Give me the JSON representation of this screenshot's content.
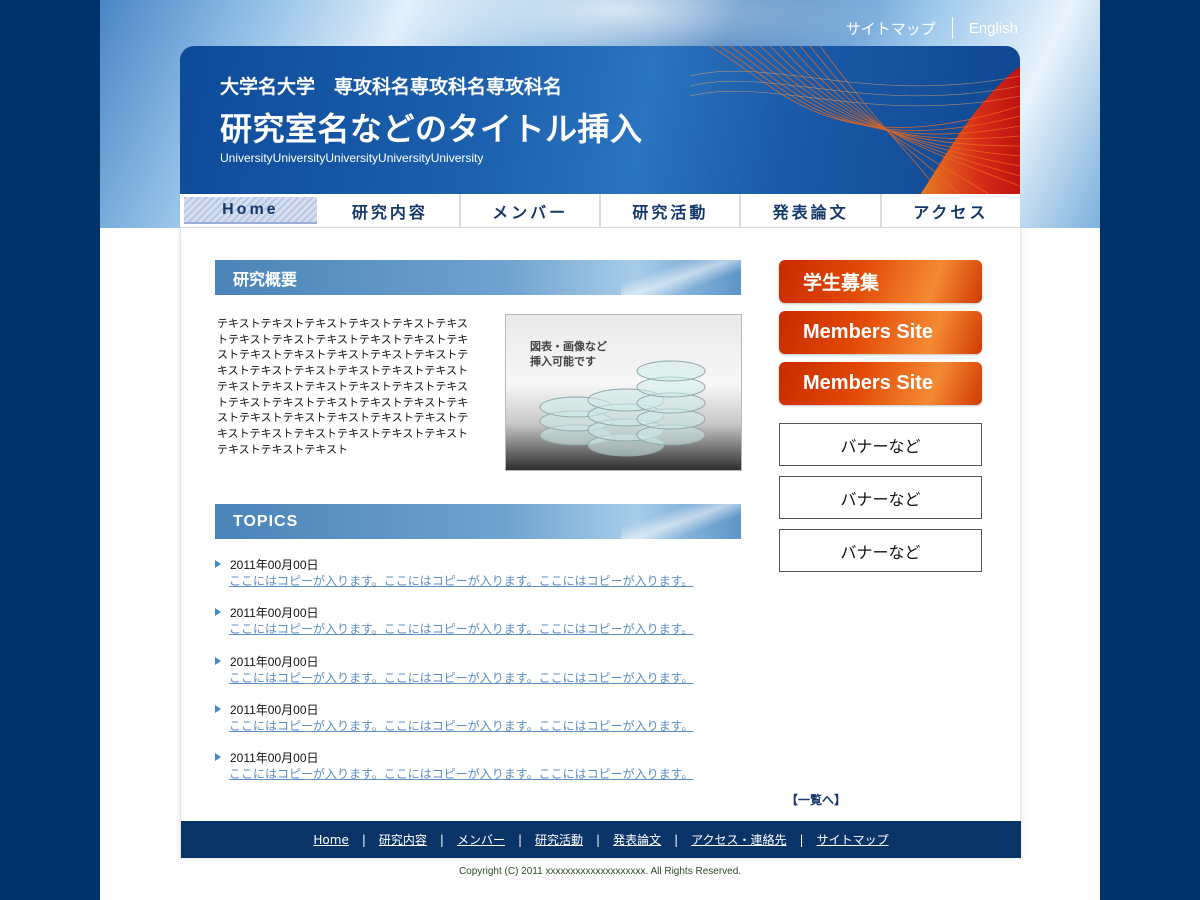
{
  "top_links": {
    "sitemap": "サイトマップ",
    "english": "English"
  },
  "header": {
    "university": "大学名大学　専攻科名専攻科名専攻科名",
    "lab_title": "研究室名などのタイトル挿入",
    "subtitle": "UniversityUniversityUniversityUniversityUniversity"
  },
  "nav": {
    "tabs": [
      {
        "label": "Home",
        "active": true
      },
      {
        "label": "研究内容"
      },
      {
        "label": "メンバー"
      },
      {
        "label": "研究活動"
      },
      {
        "label": "発表論文"
      },
      {
        "label": "アクセス"
      }
    ]
  },
  "overview": {
    "heading": "研究概要",
    "text": "テキストテキストテキストテキストテキストテキストテキストテキストテキストテキストテキストテキストテキストテキストテキストテキストテキストテキストテキストテキストテキストテキストテキストテキストテキストテキストテキストテキストテキストテキストテキストテキストテキストテキストテキストテキストテキストテキストテキストテキストテキストテキストテキストテキストテキストテキストテキストテキストテキスト",
    "figure_caption_1": "図表・画像など",
    "figure_caption_2": "挿入可能です"
  },
  "topics": {
    "heading": "TOPICS",
    "items": [
      {
        "date": "2011年00月00日",
        "text": "ここにはコピーが入ります。ここにはコピーが入ります。ここにはコピーが入ります。"
      },
      {
        "date": "2011年00月00日",
        "text": "ここにはコピーが入ります。ここにはコピーが入ります。ここにはコピーが入ります。"
      },
      {
        "date": "2011年00月00日",
        "text": "ここにはコピーが入ります。ここにはコピーが入ります。ここにはコピーが入ります。"
      },
      {
        "date": "2011年00月00日",
        "text": "ここにはコピーが入ります。ここにはコピーが入ります。ここにはコピーが入ります。"
      },
      {
        "date": "2011年00月00日",
        "text": "ここにはコピーが入ります。ここにはコピーが入ります。ここにはコピーが入ります。"
      }
    ],
    "more": "【一覧へ】"
  },
  "sidebar": {
    "recruit": "学生募集",
    "members_1": "Members Site",
    "members_2": "Members Site",
    "banners": [
      "バナーなど",
      "バナーなど",
      "バナーなど"
    ]
  },
  "footer": {
    "links": [
      "Home",
      "研究内容",
      "メンバー",
      "研究活動",
      "発表論文",
      "アクセス・連絡先",
      "サイトマップ"
    ],
    "separator": "|",
    "copyright": "Copyright (C) 2011 xxxxxxxxxxxxxxxxxxxx. All Rights Reserved."
  },
  "colors": {
    "page_bg": "#00336a",
    "nav_text": "#15386a",
    "accent_orange": "#e24a06",
    "link_blue": "#5a8ec4",
    "footer_bg": "#0a3468"
  }
}
